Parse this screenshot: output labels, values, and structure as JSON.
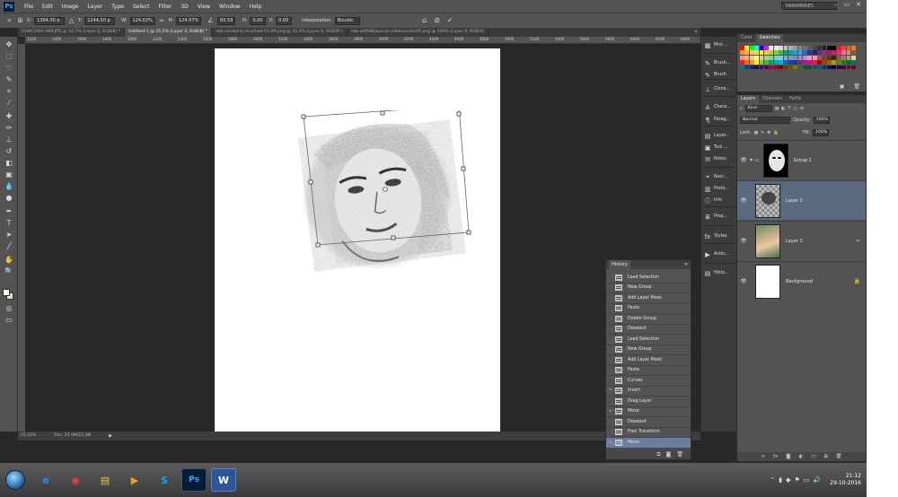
{
  "app": {
    "logo": "Ps",
    "workspace": "PARAMNNES"
  },
  "menu": [
    "File",
    "Edit",
    "Image",
    "Layer",
    "Type",
    "Select",
    "Filter",
    "3D",
    "View",
    "Window",
    "Help"
  ],
  "window_controls": [
    "–",
    "▭",
    "✕"
  ],
  "options": {
    "x_label": "X:",
    "x_value": "1364,00 p",
    "y_label": "Y:",
    "y_value": "1244,50 p",
    "w_label": "W:",
    "w_value": "124,02%",
    "h_label": "H:",
    "h_value": "124,07%",
    "angle_value": "83,59",
    "hskew_label": "H:",
    "hskew_value": "0,00",
    "vskew_label": "V:",
    "vskew_value": "0,00",
    "interp_label": "Interpolation:",
    "interp_value": "Bicubic"
  },
  "tabs": [
    {
      "label": "51WE5064-099.JPG @ 16,7% (Layer 0, RGB/8) *",
      "active": false
    },
    {
      "label": "Untitled-1 @ 25,5% (Layer 2, RGB/8) *",
      "active": true
    },
    {
      "label": "nbk-randomly-brushed-01-09.png @ 33,3% (Layer 0, RGB/8*)",
      "active": false
    },
    {
      "label": "nbk-artANDjournal-urbanmasks06.png @ 100% (Layer 0, RGB/8)",
      "active": false
    }
  ],
  "ruler_labels": [
    "1200",
    "1400",
    "1600",
    "1800",
    "2000",
    "2200",
    "2400",
    "2600",
    "2800",
    "3000",
    "3200",
    "3400",
    "3600",
    "3800",
    "4000",
    "4200",
    "4400",
    "4600",
    "4800",
    "5000",
    "5200",
    "5400",
    "5600",
    "5800",
    "6000",
    "6200",
    "6400"
  ],
  "status": {
    "zoom": "25,52%",
    "doc": "Doc: 24,9M/23,3M"
  },
  "history": {
    "title": "History",
    "items": [
      {
        "label": "Load Selection",
        "selected": false
      },
      {
        "label": "New Group",
        "selected": false
      },
      {
        "label": "Add Layer Mask",
        "selected": false
      },
      {
        "label": "Paste",
        "selected": false
      },
      {
        "label": "Delete Group",
        "selected": false
      },
      {
        "label": "Deselect",
        "selected": false
      },
      {
        "label": "Load Selection",
        "selected": false
      },
      {
        "label": "New Group",
        "selected": false
      },
      {
        "label": "Add Layer Mask",
        "selected": false
      },
      {
        "label": "Paste",
        "selected": false
      },
      {
        "label": "Curves",
        "selected": false
      },
      {
        "label": "Invert",
        "selected": false
      },
      {
        "label": "Drag Layer",
        "selected": false
      },
      {
        "label": "Move",
        "selected": false
      },
      {
        "label": "Deselect",
        "selected": false
      },
      {
        "label": "Free Transform",
        "selected": false
      },
      {
        "label": "Move",
        "selected": true
      }
    ]
  },
  "dock": [
    "Mini ...",
    "Brush...",
    "Brush",
    "Clone...",
    "Chara...",
    "Parag...",
    "Layer...",
    "Tool ...",
    "Notes",
    "Navi...",
    "Histo...",
    "Info",
    "Prop...",
    "Styles",
    "Actio...",
    "Histo..."
  ],
  "swatch_tabs": [
    {
      "label": "Color",
      "active": false
    },
    {
      "label": "Swatches",
      "active": true
    }
  ],
  "swatch_colors": [
    "#ff0000",
    "#ffff00",
    "#00ff00",
    "#00ffff",
    "#0000ff",
    "#ff00ff",
    "#ffffff",
    "#ebebeb",
    "#d6d6d6",
    "#c2c2c2",
    "#adadad",
    "#999999",
    "#858585",
    "#707070",
    "#5c5c5c",
    "#474747",
    "#333333",
    "#1f1f1f",
    "#0a0a0a",
    "#000000",
    "#ed1c24",
    "#ee4036",
    "#f05a28",
    "#f47920",
    "#f7941d",
    "#fbb040",
    "#fcc66d",
    "#ffde17",
    "#fff200",
    "#d7df23",
    "#a6ce39",
    "#8dc63f",
    "#39b54a",
    "#00a651",
    "#00a99d",
    "#00aeef",
    "#27aae1",
    "#1c75bc",
    "#2e3192",
    "#262262",
    "#662d91",
    "#92278f",
    "#9e1f63",
    "#da1c5c",
    "#ee2a7b",
    "#f06eaa",
    "#c49a6c",
    "#8b5e3c",
    "#f7977a",
    "#f9ad81",
    "#fdc68a",
    "#fff79a",
    "#c4df9b",
    "#a2d39c",
    "#82ca9d",
    "#7bcdc8",
    "#6ecff6",
    "#7ea7d8",
    "#8493ca",
    "#8882be",
    "#a187be",
    "#bc8dbf",
    "#f49ac2",
    "#f6989d",
    "#9a5a3c",
    "#754c24",
    "#603913",
    "#3c2415",
    "#8c6239",
    "#a67c52",
    "#c69c6d",
    "#e6cda4",
    "#ed1c24",
    "#f26522",
    "#f7941d",
    "#fff200",
    "#8dc63f",
    "#39b54a",
    "#00a651",
    "#00a99d",
    "#00aeef",
    "#0072bc",
    "#0054a6",
    "#2e3192",
    "#662d91",
    "#92278f",
    "#ec008c",
    "#ed145b",
    "#9e0b0f",
    "#a0410d",
    "#a36209",
    "#aba000",
    "#598527",
    "#1a7b30",
    "#007236",
    "#00746b",
    "#0076a3",
    "#004b80",
    "#003471",
    "#1b1464",
    "#440e62",
    "#630460",
    "#9e005d",
    "#9e0039",
    "#790000",
    "#7b2e00",
    "#7d4900",
    "#827b00",
    "#406618",
    "#005e20",
    "#005826",
    "#005952",
    "#005b7f",
    "#003663",
    "#002157",
    "#0d004c",
    "#32004b",
    "#4b0049",
    "#7b0046",
    "#7a0026"
  ],
  "layers_tabs": [
    {
      "label": "Layers",
      "active": true
    },
    {
      "label": "Channels",
      "active": false
    },
    {
      "label": "Paths",
      "active": false
    }
  ],
  "layers_controls": {
    "kind": "Kind",
    "blend_mode": "Normal",
    "opacity_label": "Opacity:",
    "opacity_value": "100%",
    "lock_label": "Lock:",
    "fill_label": "Fill:",
    "fill_value": "100%"
  },
  "layers": [
    {
      "name": "Group 1",
      "selected": false,
      "italic": false
    },
    {
      "name": "Layer 2",
      "selected": true,
      "italic": false
    },
    {
      "name": "Layer 1",
      "selected": false,
      "italic": false
    },
    {
      "name": "Background",
      "selected": false,
      "italic": true
    }
  ],
  "taskbar": {
    "apps": [
      {
        "name": "explorer-ie",
        "glyph": "e",
        "color": "#1e90ff",
        "active": false
      },
      {
        "name": "chrome",
        "glyph": "◉",
        "color": "#e94235",
        "active": false
      },
      {
        "name": "file-explorer",
        "glyph": "▤",
        "color": "#f0c24b",
        "active": false
      },
      {
        "name": "media-player",
        "glyph": "▶",
        "color": "#ff9a1f",
        "active": false
      },
      {
        "name": "skype",
        "glyph": "S",
        "color": "#00aff0",
        "active": false
      },
      {
        "name": "photoshop",
        "glyph": "Ps",
        "color": "#31a8ff",
        "active": true
      },
      {
        "name": "word",
        "glyph": "W",
        "color": "#2b579a",
        "active": true
      }
    ],
    "time": "21:12",
    "date": "29-10-2016"
  }
}
